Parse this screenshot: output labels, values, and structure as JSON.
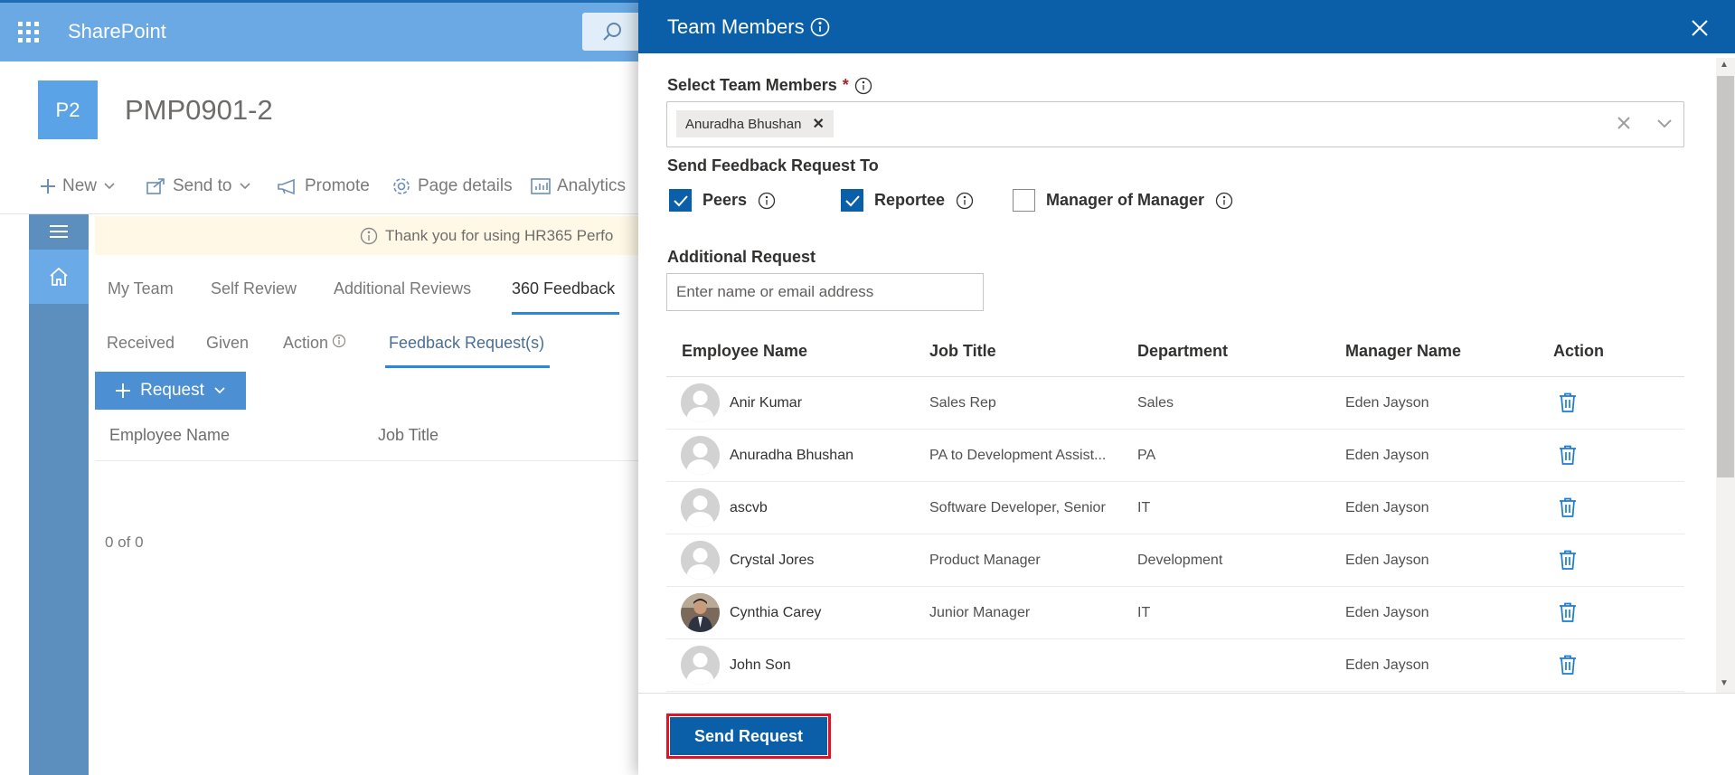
{
  "suite_bar": {
    "brand": "SharePoint"
  },
  "site": {
    "logo_text": "P2",
    "title": "PMP0901-2"
  },
  "command_bar": {
    "new": "New",
    "send_to": "Send to",
    "promote": "Promote",
    "page_details": "Page details",
    "analytics": "Analytics"
  },
  "banner": {
    "text": "Thank you for using HR365 Perfo"
  },
  "main_tabs": [
    "My Team",
    "Self Review",
    "Additional Reviews",
    "360 Feedback"
  ],
  "sub_tabs": [
    "Received",
    "Given",
    "Action",
    "Feedback Request(s)"
  ],
  "request_button": "Request",
  "background_table": {
    "headers": [
      "Employee Name",
      "Job Title"
    ],
    "count": "0 of 0"
  },
  "panel": {
    "title": "Team Members",
    "select_label": "Select Team Members",
    "required_mark": "*",
    "selected_chip": "Anuradha Bhushan",
    "send_to_label": "Send Feedback Request To",
    "options": [
      {
        "label": "Peers",
        "checked": true
      },
      {
        "label": "Reportee",
        "checked": true
      },
      {
        "label": "Manager of Manager",
        "checked": false
      }
    ],
    "additional_label": "Additional Request",
    "additional_placeholder": "Enter name or email address",
    "table": {
      "headers": [
        "Employee Name",
        "Job Title",
        "Department",
        "Manager Name",
        "Action"
      ],
      "rows": [
        {
          "name": "Anir Kumar",
          "job": "Sales Rep",
          "dept": "Sales",
          "manager": "Eden Jayson",
          "photo": false
        },
        {
          "name": "Anuradha Bhushan",
          "job": "PA to Development Assist...",
          "dept": "PA",
          "manager": "Eden Jayson",
          "photo": false
        },
        {
          "name": "ascvb",
          "job": "Software Developer, Senior",
          "dept": "IT",
          "manager": "Eden Jayson",
          "photo": false
        },
        {
          "name": "Crystal Jores",
          "job": "Product Manager",
          "dept": "Development",
          "manager": "Eden Jayson",
          "photo": false
        },
        {
          "name": "Cynthia Carey",
          "job": "Junior Manager",
          "dept": "IT",
          "manager": "Eden Jayson",
          "photo": true
        },
        {
          "name": "John Son",
          "job": "",
          "dept": "",
          "manager": "Eden Jayson",
          "photo": false
        }
      ]
    },
    "send_button": "Send Request"
  },
  "colors": {
    "suite_bar": "#6aa9e3",
    "panel_header": "#0a5fa8",
    "accent": "#2b88d8",
    "highlight_border": "#e81123"
  }
}
